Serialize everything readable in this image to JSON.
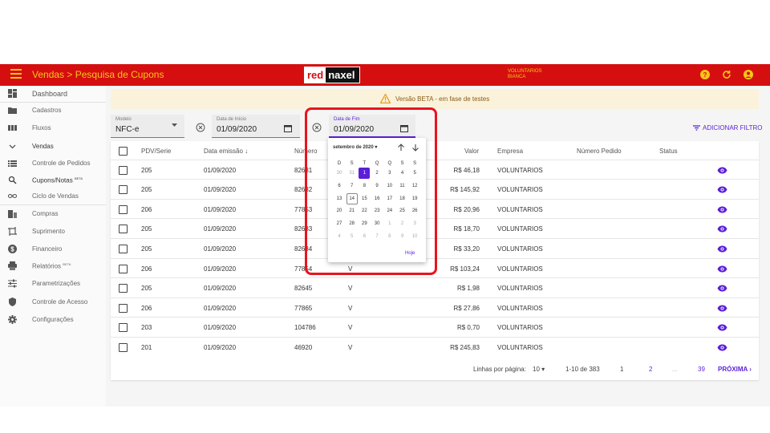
{
  "header": {
    "title": "Vendas > Pesquisa de Cupons",
    "logo_red": "red",
    "logo_dark": "naxel",
    "company_line1": "VOLUNTARIOS",
    "company_line2": "BIANCA"
  },
  "sidebar": {
    "items": [
      {
        "label": "Dashboard",
        "icon": "dashboard-icon"
      },
      {
        "label": "Cadastros",
        "icon": "folder-icon"
      },
      {
        "label": "Fluxos",
        "icon": "columns-icon"
      },
      {
        "label": "Vendas",
        "icon": "chevron-down-icon"
      },
      {
        "label": "Controle de Pedidos",
        "icon": "list-icon"
      },
      {
        "label": "Cupons/Notas",
        "badge": "BETA",
        "icon": "search-icon"
      },
      {
        "label": "Ciclo de Vendas",
        "icon": "infinity-icon"
      },
      {
        "label": "Compras",
        "icon": "building-icon"
      },
      {
        "label": "Suprimento",
        "icon": "crop-icon"
      },
      {
        "label": "Financeiro",
        "icon": "dollar-icon"
      },
      {
        "label": "Relatórios",
        "badge": "BETA",
        "icon": "print-icon"
      },
      {
        "label": "Parametrizações",
        "icon": "sliders-icon"
      },
      {
        "label": "Controle de Acesso",
        "icon": "shield-icon"
      },
      {
        "label": "Configurações",
        "icon": "gear-icon"
      }
    ]
  },
  "banner": {
    "text": "Versão BETA - em fase de testes"
  },
  "filters": {
    "modelo_label": "Modelo",
    "modelo_value": "NFC-e",
    "inicio_label": "Data de Início",
    "inicio_value": "01/09/2020",
    "fim_label": "Data de Fim",
    "fim_value": "01/09/2020",
    "add_filter": "ADICIONAR FILTRO"
  },
  "calendar": {
    "month_label": "setembro de 2020",
    "weekday_headers": [
      "D",
      "S",
      "T",
      "Q",
      "Q",
      "S",
      "S"
    ],
    "weeks": [
      [
        "30",
        "31",
        "1",
        "2",
        "3",
        "4",
        "5"
      ],
      [
        "6",
        "7",
        "8",
        "9",
        "10",
        "11",
        "12"
      ],
      [
        "13",
        "14",
        "15",
        "16",
        "17",
        "18",
        "19"
      ],
      [
        "20",
        "21",
        "22",
        "23",
        "24",
        "25",
        "26"
      ],
      [
        "27",
        "28",
        "29",
        "30",
        "1",
        "2",
        "3"
      ],
      [
        "4",
        "5",
        "6",
        "7",
        "8",
        "9",
        "10"
      ]
    ],
    "selected_day": "1",
    "today_day": "14",
    "today_button": "Hoje"
  },
  "table": {
    "headers": {
      "pdv": "PDV/Serie",
      "data": "Data emissão",
      "numero": "Número",
      "valor": "Valor",
      "empresa": "Empresa",
      "pedido": "Número Pedido",
      "status": "Status"
    },
    "rows": [
      {
        "pdv": "205",
        "data": "01/09/2020",
        "numero": "82631",
        "tipo": "",
        "valor": "R$ 46,18",
        "empresa": "VOLUNTARIOS"
      },
      {
        "pdv": "205",
        "data": "01/09/2020",
        "numero": "82632",
        "tipo": "",
        "valor": "R$ 145,92",
        "empresa": "VOLUNTARIOS"
      },
      {
        "pdv": "206",
        "data": "01/09/2020",
        "numero": "77853",
        "tipo": "",
        "valor": "R$ 20,96",
        "empresa": "VOLUNTARIOS"
      },
      {
        "pdv": "205",
        "data": "01/09/2020",
        "numero": "82633",
        "tipo": "",
        "valor": "R$ 18,70",
        "empresa": "VOLUNTARIOS"
      },
      {
        "pdv": "205",
        "data": "01/09/2020",
        "numero": "82634",
        "tipo": "",
        "valor": "R$ 33,20",
        "empresa": "VOLUNTARIOS"
      },
      {
        "pdv": "206",
        "data": "01/09/2020",
        "numero": "77854",
        "tipo": "V",
        "valor": "R$ 103,24",
        "empresa": "VOLUNTARIOS"
      },
      {
        "pdv": "205",
        "data": "01/09/2020",
        "numero": "82645",
        "tipo": "V",
        "valor": "R$ 1,98",
        "empresa": "VOLUNTARIOS"
      },
      {
        "pdv": "206",
        "data": "01/09/2020",
        "numero": "77865",
        "tipo": "V",
        "valor": "R$ 27,86",
        "empresa": "VOLUNTARIOS"
      },
      {
        "pdv": "203",
        "data": "01/09/2020",
        "numero": "104786",
        "tipo": "V",
        "valor": "R$ 0,70",
        "empresa": "VOLUNTARIOS"
      },
      {
        "pdv": "201",
        "data": "01/09/2020",
        "numero": "46920",
        "tipo": "V",
        "valor": "R$ 245,83",
        "empresa": "VOLUNTARIOS"
      }
    ]
  },
  "pagination": {
    "rows_per_page_label": "Linhas por página:",
    "rows_per_page": "10",
    "range": "1-10 de 383",
    "page1": "1",
    "page2": "2",
    "ellipsis": "...",
    "last_page": "39",
    "next": "PRÓXIMA"
  },
  "colors": {
    "brand_red": "#d50f0f",
    "accent_yellow": "#f5c518",
    "accent_purple": "#5b1fd8"
  }
}
